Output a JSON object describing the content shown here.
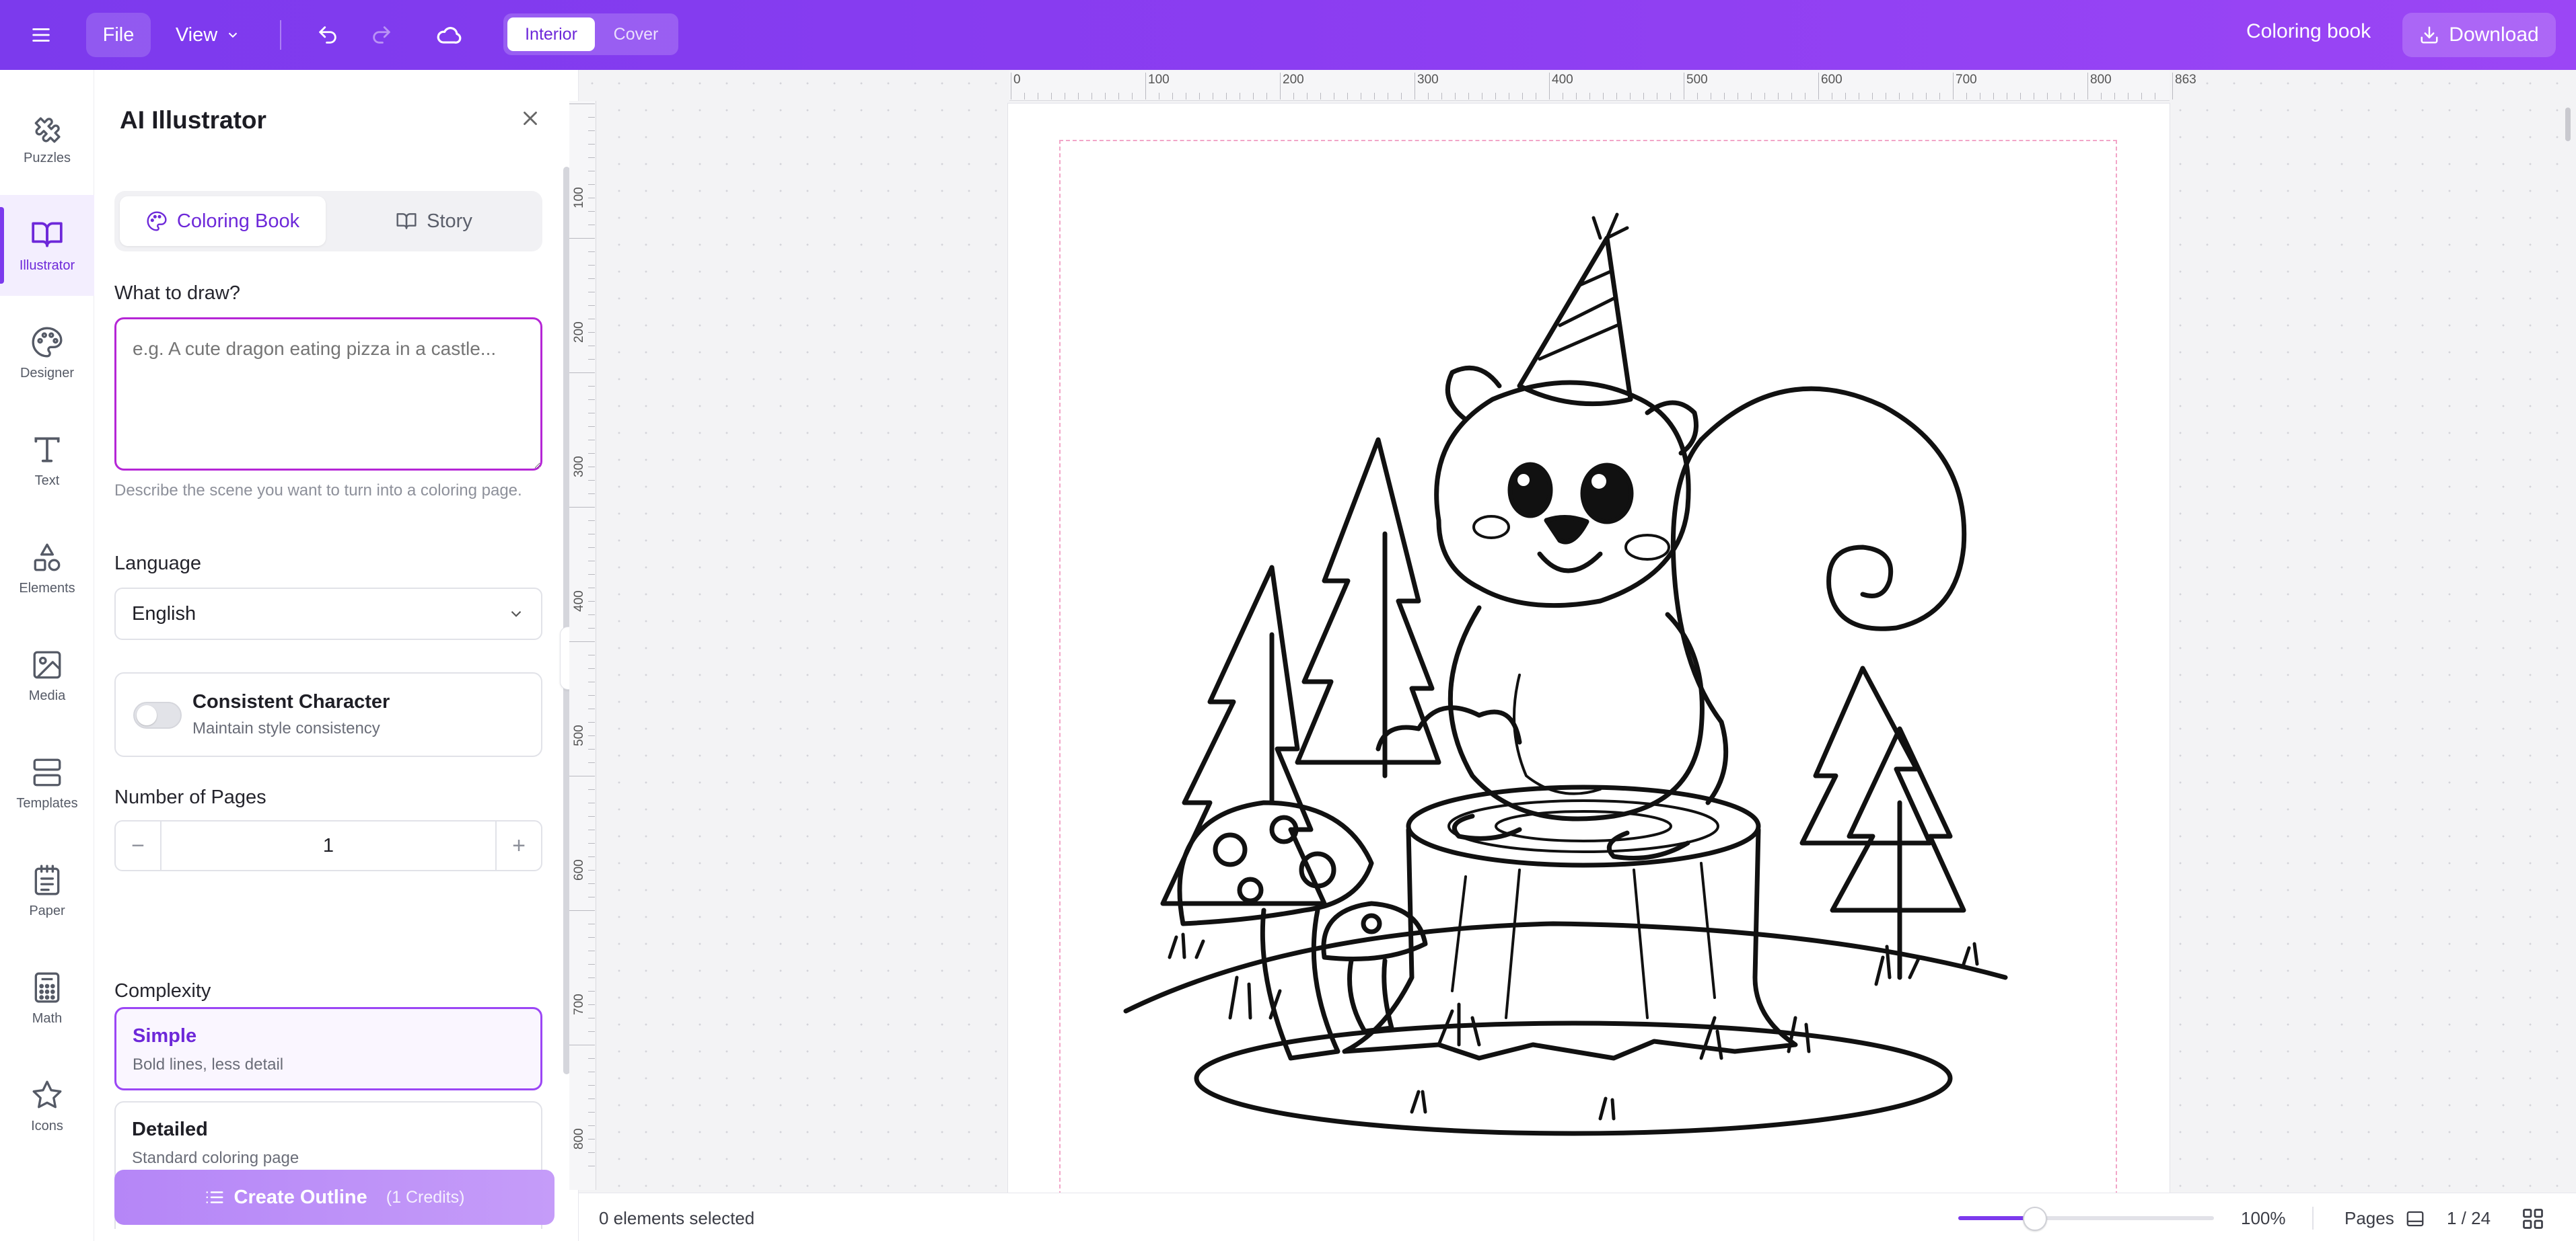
{
  "topbar": {
    "file_label": "File",
    "view_label": "View",
    "segment": {
      "interior": "Interior",
      "cover": "Cover",
      "selected": "Interior"
    },
    "project_title": "Coloring book",
    "download_label": "Download"
  },
  "rail": {
    "items": [
      {
        "label": "Puzzles",
        "icon": "puzzle-icon"
      },
      {
        "label": "Illustrator",
        "icon": "book-icon",
        "active": true
      },
      {
        "label": "Designer",
        "icon": "palette-icon"
      },
      {
        "label": "Text",
        "icon": "text-icon"
      },
      {
        "label": "Elements",
        "icon": "shapes-icon"
      },
      {
        "label": "Media",
        "icon": "image-icon"
      },
      {
        "label": "Templates",
        "icon": "templates-icon"
      },
      {
        "label": "Paper",
        "icon": "paper-icon"
      },
      {
        "label": "Math",
        "icon": "calculator-icon"
      },
      {
        "label": "Icons",
        "icon": "star-icon"
      }
    ]
  },
  "panel": {
    "title": "AI Illustrator",
    "tabs": [
      {
        "label": "Coloring Book",
        "icon": "palette-icon",
        "active": true
      },
      {
        "label": "Story",
        "icon": "book-open-icon",
        "active": false
      }
    ],
    "prompt": {
      "label": "What to draw?",
      "placeholder": "e.g. A cute dragon eating pizza in a castle...",
      "value": "",
      "hint": "Describe the scene you want to turn into a coloring page."
    },
    "language": {
      "label": "Language",
      "value": "English"
    },
    "consistent_character": {
      "title": "Consistent Character",
      "subtitle": "Maintain style consistency",
      "enabled": false
    },
    "pages": {
      "label": "Number of Pages",
      "value": "1",
      "minus": "−",
      "plus": "+"
    },
    "complexity": {
      "label": "Complexity",
      "options": [
        {
          "title": "Simple",
          "subtitle": "Bold lines, less detail",
          "selected": true
        },
        {
          "title": "Detailed",
          "subtitle": "Standard coloring page",
          "selected": false
        }
      ]
    },
    "create_button": {
      "label": "Create Outline",
      "credits": "(1 Credits)"
    }
  },
  "ruler": {
    "top": [
      "0",
      "100",
      "200",
      "300",
      "400",
      "500",
      "600",
      "700",
      "800",
      "863"
    ],
    "left": [
      "100",
      "200",
      "300",
      "400",
      "500",
      "600",
      "700",
      "800"
    ]
  },
  "status": {
    "selection": "0 elements selected",
    "zoom": "100%",
    "zoom_level": 0.3,
    "pages_label": "Pages",
    "page_count": "1 / 24"
  },
  "colors": {
    "accent": "#7c3aed",
    "topbar_gradient_start": "#7c3aed",
    "topbar_gradient_end": "#9b46f5",
    "prompt_border": "#b526d6",
    "page_margin": "#f2a6c8"
  }
}
